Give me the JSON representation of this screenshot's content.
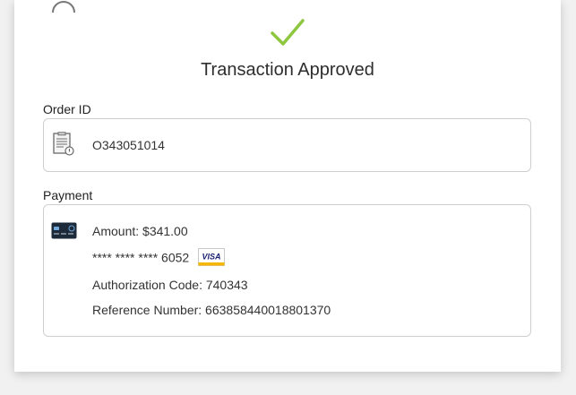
{
  "header": {
    "title": "Transaction Approved"
  },
  "order": {
    "label": "Order ID",
    "value": "O343051014"
  },
  "payment": {
    "label": "Payment",
    "amount_text": "Amount: $341.00",
    "card_masked": "**** **** **** 6052",
    "card_brand": "VISA",
    "auth_text": "Authorization Code: 740343",
    "reference_text": "Reference Number: 663858440018801370"
  },
  "colors": {
    "success": "#8dc63f",
    "card_icon": "#1c2a3a",
    "visa_blue": "#1a1f71",
    "visa_gold": "#f7b600"
  },
  "icons": {
    "approved": "checkmark-icon",
    "order": "clipboard-icon",
    "payment": "credit-card-icon",
    "brand": "visa-logo"
  }
}
